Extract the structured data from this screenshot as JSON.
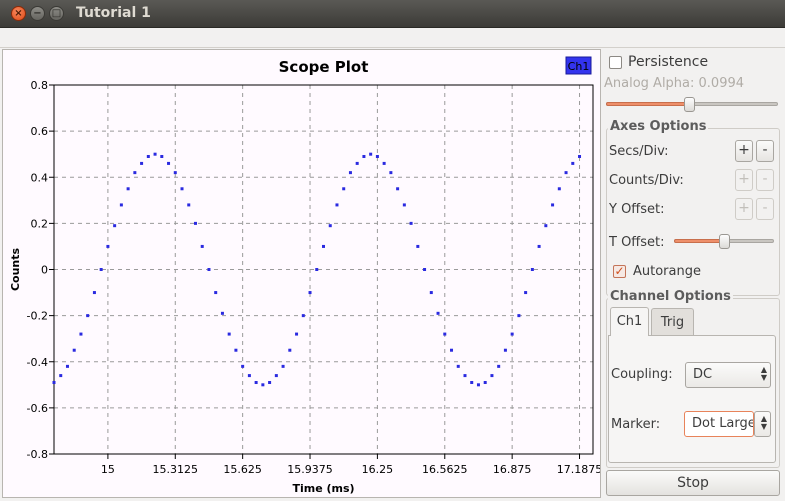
{
  "window": {
    "title": "Tutorial 1"
  },
  "panel": {
    "persistence_label": "Persistence",
    "persistence_checked": false,
    "analog_alpha_label": "Analog Alpha: 0.0994",
    "analog_alpha_level": 0.48,
    "axes_options_title": "Axes Options",
    "secs_div_label": "Secs/Div:",
    "counts_div_label": "Counts/Div:",
    "y_offset_label": "Y Offset:",
    "plus": "+",
    "minus": "-",
    "t_offset_label": "T Offset:",
    "t_offset_level": 0.5,
    "autorange_label": "Autorange",
    "autorange_checked": true,
    "channel_options_title": "Channel Options",
    "tabs": [
      "Ch1",
      "Trig"
    ],
    "coupling_label": "Coupling:",
    "coupling_value": "DC",
    "marker_label": "Marker:",
    "marker_value": "Dot Large",
    "stop_label": "Stop"
  },
  "chart_data": {
    "type": "scatter",
    "title": "Scope Plot",
    "xlabel": "Time (ms)",
    "ylabel": "Counts",
    "legend": "Ch1",
    "legend_placement": "top-right",
    "grid": true,
    "xlim": [
      14.75,
      17.25
    ],
    "ylim": [
      -0.8,
      0.8
    ],
    "x_ticks": [
      "15",
      "15.3125",
      "15.625",
      "15.9375",
      "16.25",
      "16.5625",
      "16.875",
      "17.1875"
    ],
    "x_tick_values": [
      15,
      15.3125,
      15.625,
      15.9375,
      16.25,
      16.5625,
      16.875,
      17.1875
    ],
    "y_ticks": [
      "0.8",
      "0.6",
      "0.4",
      "0.2",
      "0",
      "-0.2",
      "-0.4",
      "-0.6",
      "-0.8"
    ],
    "y_tick_values": [
      0.8,
      0.6,
      0.4,
      0.2,
      0,
      -0.2,
      -0.4,
      -0.6,
      -0.8
    ],
    "series": [
      {
        "name": "Ch1",
        "color": "#2a2ae0",
        "sample_interval_ms": 0.03125,
        "x_first": 14.75,
        "values": [
          -0.49,
          -0.46,
          -0.42,
          -0.35,
          -0.28,
          -0.2,
          -0.1,
          0.0,
          0.1,
          0.19,
          0.28,
          0.35,
          0.42,
          0.46,
          0.49,
          0.5,
          0.49,
          0.46,
          0.42,
          0.35,
          0.28,
          0.2,
          0.1,
          0.0,
          -0.1,
          -0.19,
          -0.28,
          -0.35,
          -0.42,
          -0.46,
          -0.49,
          -0.5,
          -0.49,
          -0.46,
          -0.42,
          -0.35,
          -0.28,
          -0.2,
          -0.1,
          0.0,
          0.1,
          0.19,
          0.28,
          0.35,
          0.42,
          0.46,
          0.49,
          0.5,
          0.49,
          0.46,
          0.42,
          0.35,
          0.28,
          0.2,
          0.1,
          0.0,
          -0.1,
          -0.19,
          -0.28,
          -0.35,
          -0.42,
          -0.46,
          -0.49,
          -0.5,
          -0.49,
          -0.46,
          -0.42,
          -0.35,
          -0.28,
          -0.2,
          -0.1,
          0.0,
          0.1,
          0.19,
          0.28,
          0.35,
          0.42,
          0.46,
          0.49
        ]
      }
    ]
  }
}
